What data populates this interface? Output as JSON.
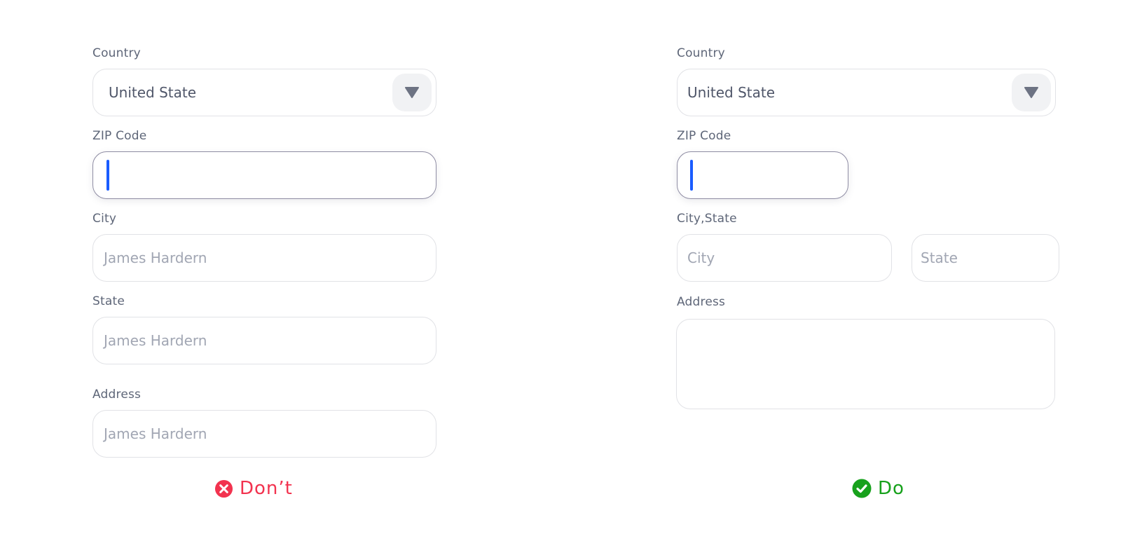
{
  "colors": {
    "dont_accent": "#f2334f",
    "do_accent": "#17a11c",
    "caret": "#1a5cff"
  },
  "dont_panel": {
    "country": {
      "label": "Country",
      "value": "United State",
      "icon": "chevron-down-icon"
    },
    "zip": {
      "label": "ZIP Code",
      "value": ""
    },
    "city": {
      "label": "City",
      "value": "James Hardern"
    },
    "state": {
      "label": "State",
      "value": "James Hardern"
    },
    "address": {
      "label": "Address",
      "value": "James Hardern"
    },
    "verdict": {
      "icon": "x-circle-icon",
      "text": "Don’t"
    }
  },
  "do_panel": {
    "country": {
      "label": "Country",
      "value": "United State",
      "icon": "chevron-down-icon"
    },
    "zip": {
      "label": "ZIP Code",
      "value": ""
    },
    "city_state": {
      "label": "City,State",
      "city_placeholder": "City",
      "state_placeholder": "State"
    },
    "address": {
      "label": "Address",
      "value": ""
    },
    "verdict": {
      "icon": "check-circle-icon",
      "text": "Do"
    }
  }
}
